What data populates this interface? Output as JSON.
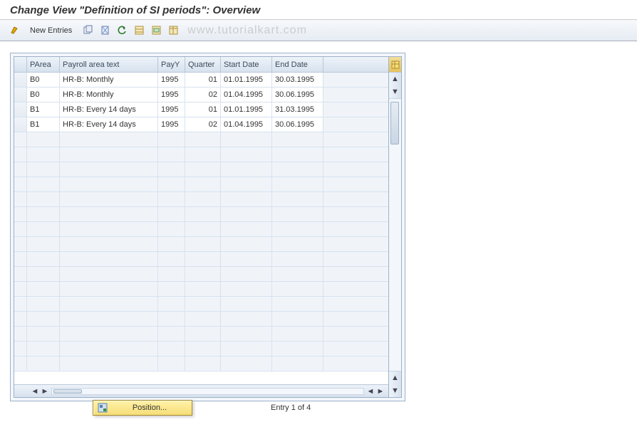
{
  "title": "Change View \"Definition of SI periods\": Overview",
  "toolbar": {
    "new_entries_label": "New Entries"
  },
  "watermark": "www.tutorialkart.com",
  "table": {
    "columns": {
      "parea": "PArea",
      "text": "Payroll area text",
      "payy": "PayY",
      "quarter": "Quarter",
      "start": "Start Date",
      "end": "End Date"
    },
    "rows": [
      {
        "parea": "B0",
        "text": "HR-B: Monthly",
        "payy": "1995",
        "quarter": "01",
        "start": "01.01.1995",
        "end": "30.03.1995"
      },
      {
        "parea": "B0",
        "text": "HR-B: Monthly",
        "payy": "1995",
        "quarter": "02",
        "start": "01.04.1995",
        "end": "30.06.1995"
      },
      {
        "parea": "B1",
        "text": "HR-B: Every 14 days",
        "payy": "1995",
        "quarter": "01",
        "start": "01.01.1995",
        "end": "31.03.1995"
      },
      {
        "parea": "B1",
        "text": "HR-B: Every 14 days",
        "payy": "1995",
        "quarter": "02",
        "start": "01.04.1995",
        "end": "30.06.1995"
      }
    ]
  },
  "footer": {
    "position_label": "Position...",
    "entry_text": "Entry 1 of 4"
  }
}
